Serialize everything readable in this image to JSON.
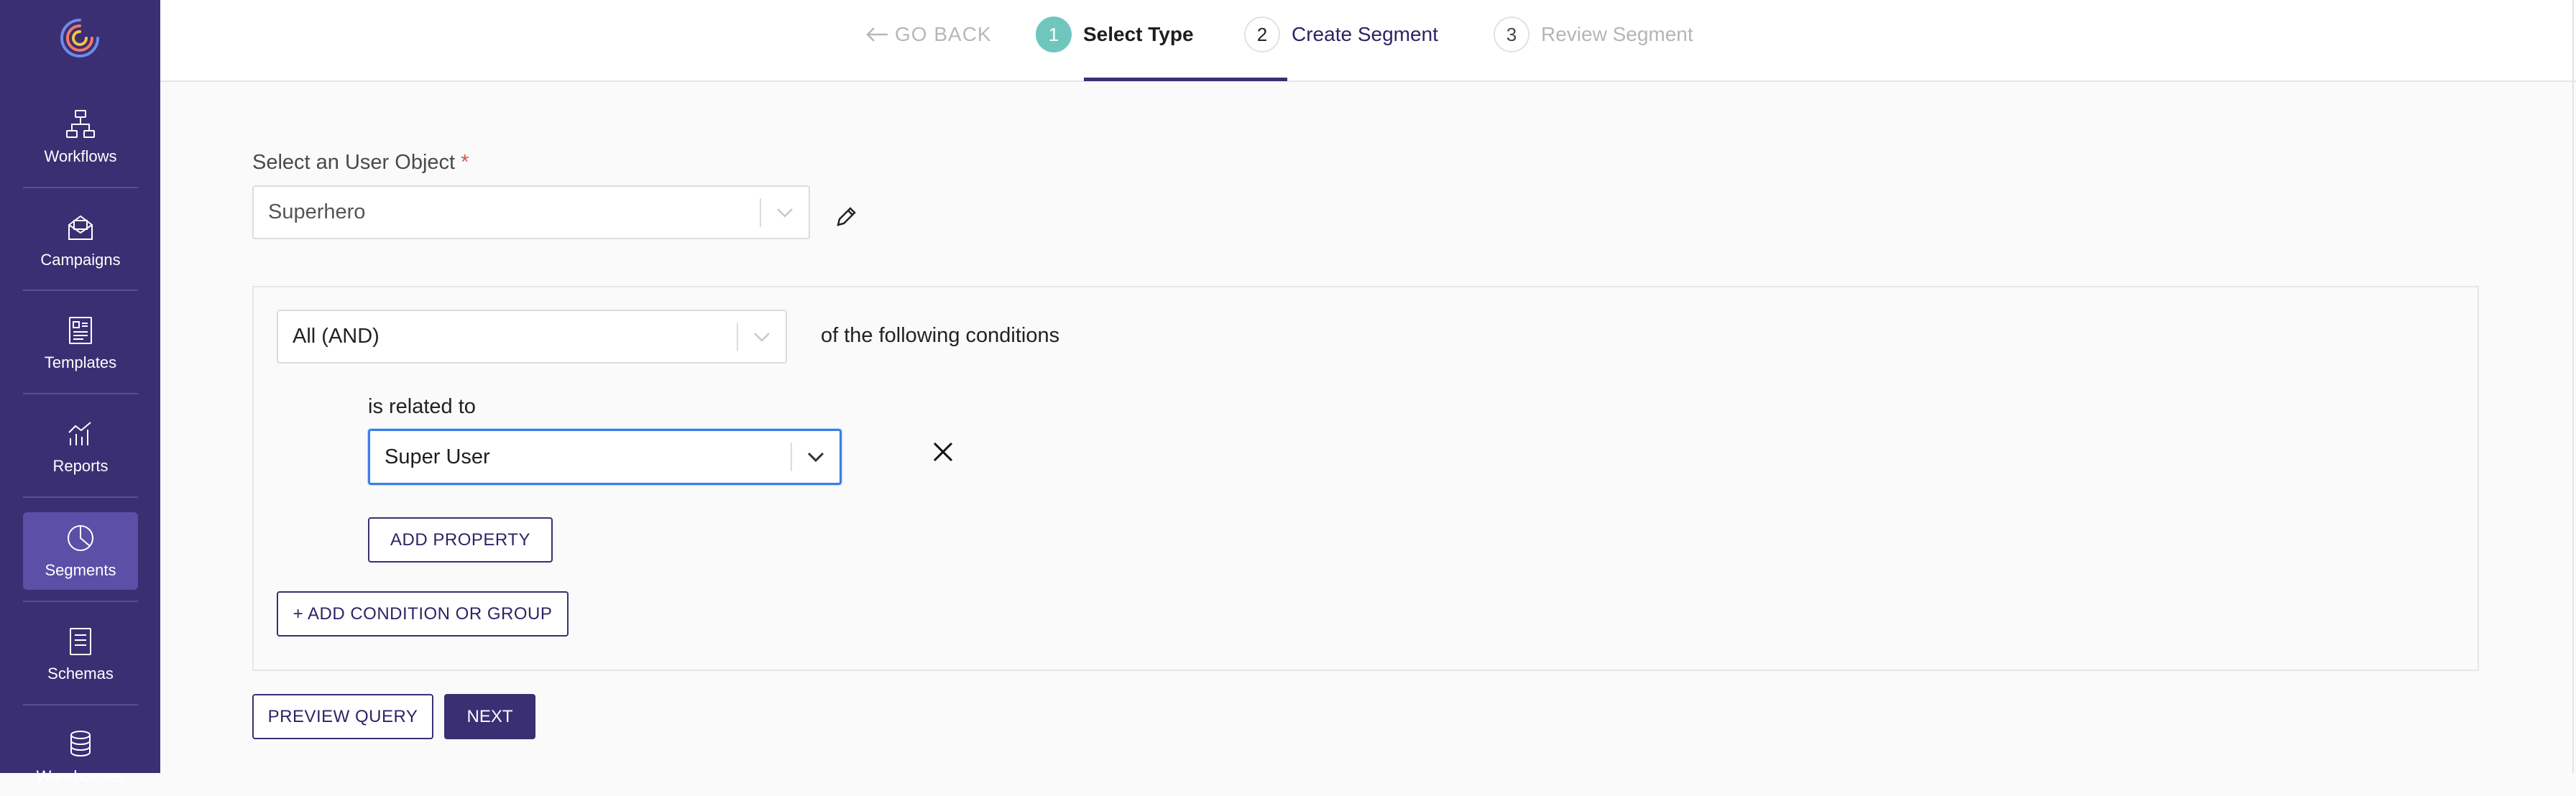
{
  "sidebar": {
    "logo_icon": "app-logo",
    "items": [
      {
        "label": "Workflows",
        "icon": "workflow-icon"
      },
      {
        "label": "Campaigns",
        "icon": "envelope-icon"
      },
      {
        "label": "Templates",
        "icon": "template-icon"
      },
      {
        "label": "Reports",
        "icon": "chart-icon"
      },
      {
        "label": "Segments",
        "icon": "pie-icon",
        "active": true
      },
      {
        "label": "Schemas",
        "icon": "document-icon"
      },
      {
        "label": "Warehouses",
        "icon": "database-icon"
      }
    ]
  },
  "stepper": {
    "go_back": "GO BACK",
    "steps": [
      {
        "number": "1",
        "label": "Select Type",
        "state": "completed"
      },
      {
        "number": "2",
        "label": "Create Segment",
        "state": "active"
      },
      {
        "number": "3",
        "label": "Review Segment",
        "state": "upcoming"
      }
    ]
  },
  "form": {
    "user_object_label": "Select an User Object",
    "required_mark": "*",
    "user_object_value": "Superhero",
    "edit_icon": "pencil-icon"
  },
  "conditions": {
    "operator_value": "All (AND)",
    "operator_suffix": "of the following conditions",
    "relation_label": "is related to",
    "relation_value": "Super User",
    "remove_icon": "close-icon",
    "add_property": "ADD PROPERTY",
    "add_condition": "+ ADD CONDITION OR GROUP"
  },
  "actions": {
    "preview": "PREVIEW QUERY",
    "next": "NEXT"
  },
  "colors": {
    "sidebar": "#3b2f73",
    "sidebar_active": "#5b4fa8",
    "step_done": "#6fc6bd",
    "focus": "#3c7ee6"
  }
}
